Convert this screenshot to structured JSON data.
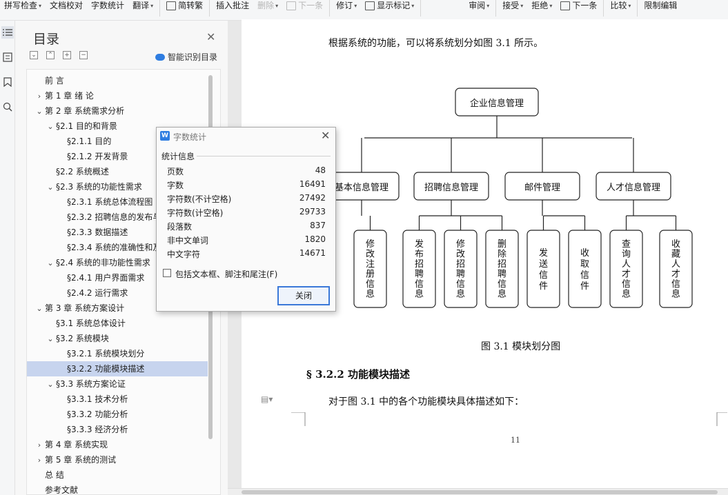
{
  "toolbar": {
    "items": [
      {
        "label": "拼写检查",
        "caret": true
      },
      {
        "label": "文档校对",
        "caret": false
      },
      {
        "label": "字数统计",
        "caret": false
      },
      {
        "label": "翻译",
        "caret": true
      },
      {
        "label": "简转繁",
        "caret": false
      },
      {
        "label": "插入批注",
        "caret": false
      },
      {
        "label": "删除",
        "caret": true,
        "disabled": true
      },
      {
        "label": "下一条",
        "caret": false,
        "disabled": true
      },
      {
        "label": "修订",
        "caret": true
      },
      {
        "label": "显示标记",
        "caret": true
      },
      {
        "label": "审阅",
        "caret": true
      },
      {
        "label": "接受",
        "caret": true
      },
      {
        "label": "拒绝",
        "caret": true
      },
      {
        "label": "下一条",
        "caret": false
      },
      {
        "label": "比较",
        "caret": true
      },
      {
        "label": "限制编辑",
        "caret": false
      }
    ]
  },
  "toc": {
    "title": "目录",
    "smart_label": "智能识别目录",
    "items": [
      {
        "label": "前    言",
        "level": 0,
        "arrow": ""
      },
      {
        "label": "第 1 章   绪  论",
        "level": 0,
        "arrow": "›"
      },
      {
        "label": "第 2 章   系统需求分析",
        "level": 0,
        "arrow": "⌄"
      },
      {
        "label": "§2.1  目的和背景",
        "level": 1,
        "arrow": "⌄"
      },
      {
        "label": "§2.1.1  目的",
        "level": 2,
        "arrow": ""
      },
      {
        "label": "§2.1.2  开发背景",
        "level": 2,
        "arrow": ""
      },
      {
        "label": "§2.2  系统概述",
        "level": 1,
        "arrow": ""
      },
      {
        "label": "§2.3  系统的功能性需求",
        "level": 1,
        "arrow": "⌄"
      },
      {
        "label": "§2.3.1  系统总体流程图",
        "level": 2,
        "arrow": ""
      },
      {
        "label": "§2.3.2  招聘信息的发布与",
        "level": 2,
        "arrow": ""
      },
      {
        "label": "§2.3.3  数据描述",
        "level": 2,
        "arrow": ""
      },
      {
        "label": "§2.3.4  系统的准确性和及",
        "level": 2,
        "arrow": ""
      },
      {
        "label": "§2.4  系统的非功能性需求",
        "level": 1,
        "arrow": "⌄"
      },
      {
        "label": "§2.4.1  用户界面需求",
        "level": 2,
        "arrow": ""
      },
      {
        "label": "§2.4.2  运行需求",
        "level": 2,
        "arrow": ""
      },
      {
        "label": "第 3 章   系统方案设计",
        "level": 0,
        "arrow": "⌄"
      },
      {
        "label": "§3.1  系统总体设计",
        "level": 1,
        "arrow": ""
      },
      {
        "label": "§3.2  系统模块",
        "level": 1,
        "arrow": "⌄"
      },
      {
        "label": "§3.2.1  系统模块划分",
        "level": 2,
        "arrow": ""
      },
      {
        "label": "§3.2.2  功能模块描述",
        "level": 2,
        "arrow": "",
        "selected": true
      },
      {
        "label": "§3.3   系统方案论证",
        "level": 1,
        "arrow": "⌄"
      },
      {
        "label": "§3.3.1  技术分析",
        "level": 2,
        "arrow": ""
      },
      {
        "label": "§3.3.2  功能分析",
        "level": 2,
        "arrow": ""
      },
      {
        "label": "§3.3.3  经济分析",
        "level": 2,
        "arrow": ""
      },
      {
        "label": "第 4 章   系统实现",
        "level": 0,
        "arrow": "›"
      },
      {
        "label": "第 5 章   系统的测试",
        "level": 0,
        "arrow": "›"
      },
      {
        "label": "总  结",
        "level": 0,
        "arrow": ""
      },
      {
        "label": "参考文献",
        "level": 0,
        "arrow": ""
      }
    ]
  },
  "document": {
    "intro": "根据系统的功能，可以将系统划分如图 3.1 所示。",
    "figure_caption": "图 3.1  模块划分图",
    "heading": "§ 3.2.2 功能模块描述",
    "para": "对于图 3.1 中的各个功能模块具体描述如下：",
    "page_number": "11",
    "org": {
      "root": "企业信息管理",
      "groups": [
        {
          "label": "基本信息管理",
          "children": [
            "修改注册信息"
          ]
        },
        {
          "label": "招聘信息管理",
          "children": [
            "发布招聘信息",
            "修改招聘信息",
            "删除招聘信息"
          ]
        },
        {
          "label": "邮件管理",
          "children": [
            "发送信件",
            "收取信件"
          ]
        },
        {
          "label": "人才信息管理",
          "children": [
            "查询人才信息",
            "收藏人才信息"
          ]
        }
      ]
    }
  },
  "dialog": {
    "title": "字数统计",
    "section": "统计信息",
    "stats": [
      {
        "label": "页数",
        "value": "48"
      },
      {
        "label": "字数",
        "value": "16491"
      },
      {
        "label": "字符数(不计空格)",
        "value": "27492"
      },
      {
        "label": "字符数(计空格)",
        "value": "29733"
      },
      {
        "label": "段落数",
        "value": "837"
      },
      {
        "label": "非中文单词",
        "value": "1820"
      },
      {
        "label": "中文字符",
        "value": "14671"
      }
    ],
    "checkbox_label": "包括文本框、脚注和尾注(F)",
    "close_label": "关闭"
  }
}
